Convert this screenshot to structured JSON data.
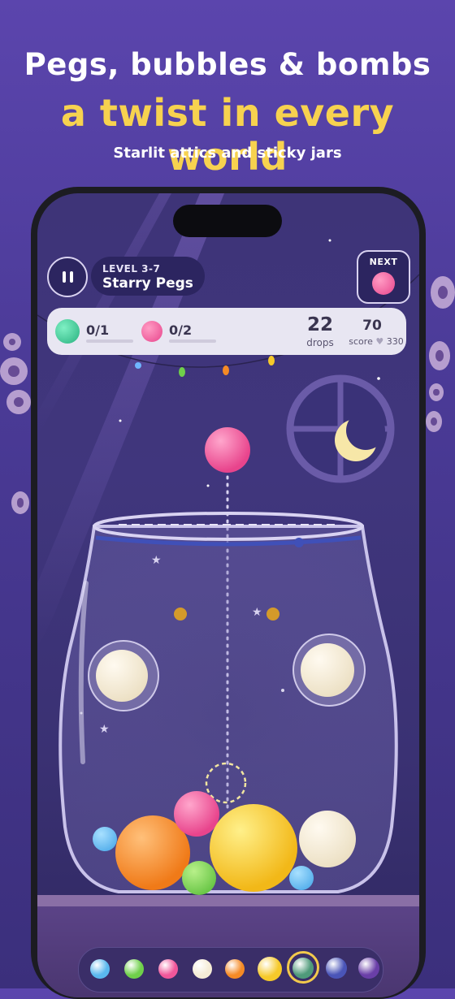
{
  "promo": {
    "line1": "Pegs, bubbles & bombs",
    "line2": "a twist in every world",
    "line3": "Starlit attics and sticky jars"
  },
  "hud": {
    "level_label": "LEVEL 3-7",
    "level_name": "Starry Pegs",
    "next_label": "NEXT",
    "goals": [
      {
        "icon": "green-fruit-icon",
        "count": "0/1",
        "color": "#3fcf9a"
      },
      {
        "icon": "pink-fruit-icon",
        "count": "0/2",
        "color": "#f0569a"
      }
    ],
    "drops_value": "22",
    "drops_label": "drops",
    "score_value": "70",
    "score_label": "score",
    "best_value": "330"
  },
  "tray": {
    "items": [
      {
        "name": "blue-fruit-icon",
        "color": "#5ab8ee"
      },
      {
        "name": "green-fruit-icon",
        "color": "#6fd04a"
      },
      {
        "name": "pink-fruit-icon",
        "color": "#f0569a"
      },
      {
        "name": "cream-fruit-icon",
        "color": "#f5ecd6"
      },
      {
        "name": "orange-fruit-icon",
        "color": "#f58a25"
      },
      {
        "name": "yellow-fruit-icon",
        "color": "#f6c92a"
      },
      {
        "name": "teal-fruit-icon",
        "color": "#4f9a7a"
      },
      {
        "name": "indigo-fruit-icon",
        "color": "#4a55b8"
      },
      {
        "name": "purple-crown-fruit-icon",
        "color": "#6a3fa8"
      }
    ]
  },
  "colors": {
    "accent": "#f7d24f",
    "bg": "#4a3a96",
    "pink": "#f0569a",
    "orange": "#f58a25",
    "yellow": "#f6c92a",
    "cream": "#f5ecd6",
    "green": "#6fd04a",
    "blue": "#5ab8ee"
  }
}
